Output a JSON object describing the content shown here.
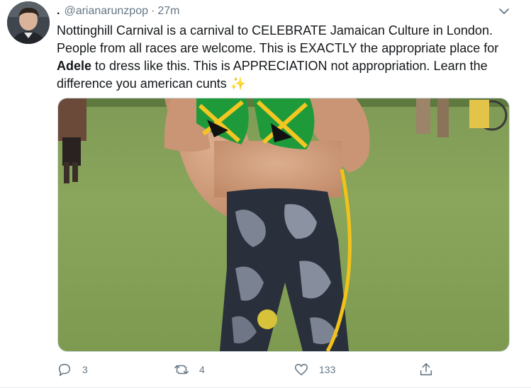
{
  "tweet": {
    "display_name": ".",
    "handle": "@arianarunzpop",
    "separator": "·",
    "time": "27m",
    "avatar_icon": "profile-avatar",
    "more_icon": "chevron-down-icon",
    "text_part1": "Nottinghill Carnival is a carnival to CELEBRATE Jamaican Culture in London. People from all races are welcome. This is EXACTLY the appropriate place for ",
    "text_bold": "Adele",
    "text_part2": " to dress like this. This is APPRECIATION not appropriation. Learn the difference you american cunts ",
    "emoji": "✨",
    "media_alt": "photo",
    "actions": {
      "reply_count": "3",
      "retweet_count": "4",
      "like_count": "133",
      "reply_icon": "reply-icon",
      "retweet_icon": "retweet-icon",
      "like_icon": "heart-icon",
      "share_icon": "share-icon"
    },
    "colors": {
      "text": "#14171a",
      "secondary": "#657786",
      "emoji": "#f5b301",
      "border": "#e6ecf0"
    }
  }
}
